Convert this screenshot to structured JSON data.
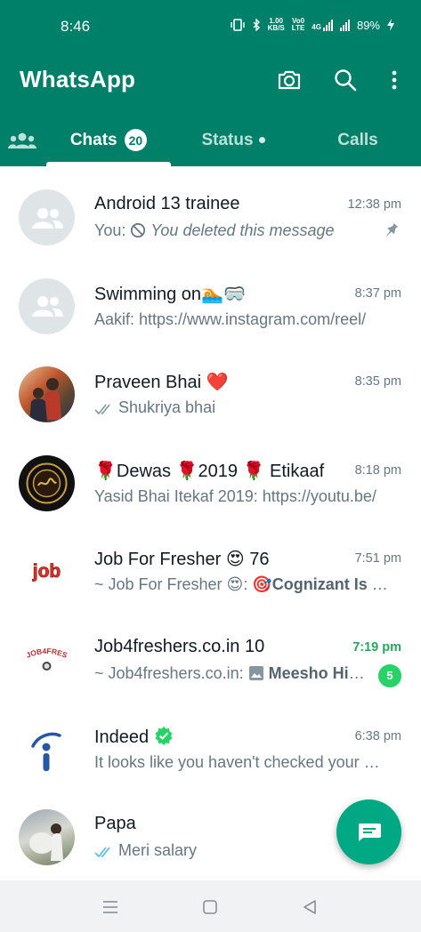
{
  "status_bar": {
    "time": "8:46",
    "network_speed_value": "1.00",
    "network_speed_unit": "KB/S",
    "volte_top": "Vo0",
    "volte_bottom": "LTE",
    "network_type": "4G",
    "battery_percent": "89%"
  },
  "app_bar": {
    "title": "WhatsApp",
    "icons": [
      "camera-icon",
      "search-icon",
      "more-vert-icon"
    ]
  },
  "tabs": {
    "community_icon": "community-icon",
    "chats_label": "Chats",
    "chats_badge": "20",
    "status_label": "Status",
    "calls_label": "Calls",
    "active": "Chats"
  },
  "chats": [
    {
      "name": "Android 13 trainee",
      "time": "12:38 pm",
      "preview_prefix": "You: ",
      "preview_text": "You deleted this message",
      "pinned": true
    },
    {
      "name": "Swimming on🏊🥽",
      "time": "8:37 pm",
      "preview": "Aakif: https://www.instagram.com/reel/"
    },
    {
      "name": "Praveen Bhai ❤️",
      "time": "8:35 pm",
      "preview": "Shukriya bhai"
    },
    {
      "name": "🌹Dewas 🌹2019 🌹 Etikaaf",
      "time": "8:18 pm",
      "preview": "Yasid Bhai Itekaf 2019: https://youtu.be/"
    },
    {
      "name": "Job For Fresher 😍 76",
      "time": "7:51 pm",
      "preview_prefix": "~ Job For Fresher 😍: 🎯",
      "preview_bold": "Cognizant Is Hiring"
    },
    {
      "name": "Job4freshers.co.in 10",
      "time": "7:19 pm",
      "preview_prefix": "~ Job4freshers.co.in: ",
      "preview_bold": "Meesho Hiring",
      "unread_count": "5"
    },
    {
      "name": "Indeed",
      "time": "6:38 pm",
      "preview": "It looks like you haven't checked your messages",
      "verified": true
    },
    {
      "name": "Papa",
      "time": "",
      "preview": "Meri salary"
    }
  ],
  "colors": {
    "header": "#008069",
    "fab": "#00a884",
    "unread": "#25d366",
    "read_tick": "#53bdeb"
  }
}
